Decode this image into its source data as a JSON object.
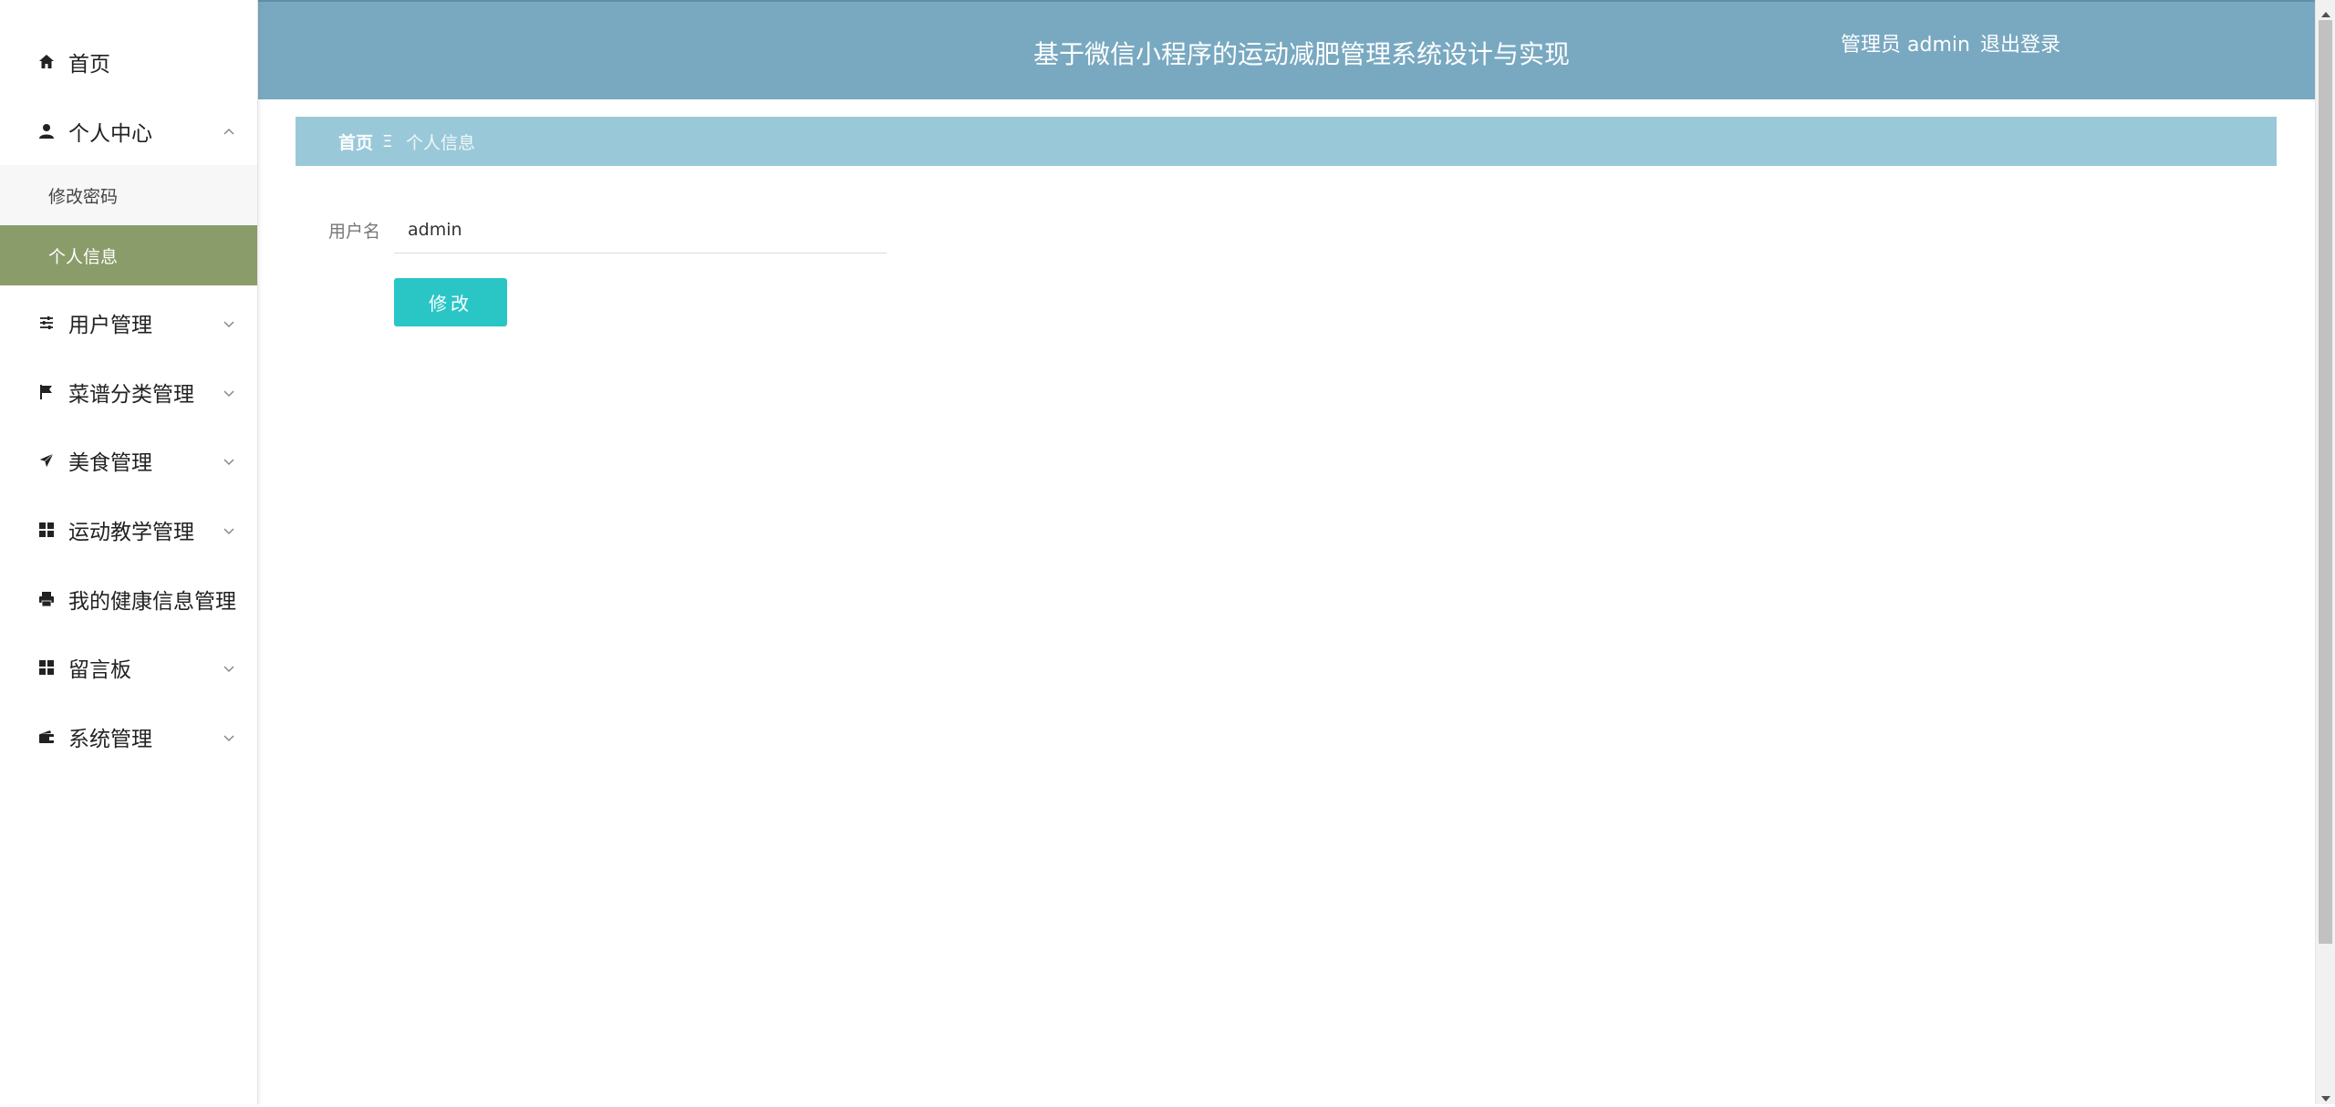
{
  "header": {
    "title": "基于微信小程序的运动减肥管理系统设计与实现",
    "user_text": "管理员 admin",
    "logout_label": "退出登录"
  },
  "sidebar": {
    "items": [
      {
        "label": "首页",
        "icon": "home-icon"
      },
      {
        "label": "个人中心",
        "icon": "user-icon",
        "expanded": true,
        "children": [
          {
            "label": "修改密码"
          },
          {
            "label": "个人信息",
            "active": true
          }
        ]
      },
      {
        "label": "用户管理",
        "icon": "sliders-icon"
      },
      {
        "label": "菜谱分类管理",
        "icon": "flag-icon"
      },
      {
        "label": "美食管理",
        "icon": "paper-plane-icon"
      },
      {
        "label": "运动教学管理",
        "icon": "grid-icon"
      },
      {
        "label": "我的健康信息管理",
        "icon": "printer-icon"
      },
      {
        "label": "留言板",
        "icon": "grid-icon"
      },
      {
        "label": "系统管理",
        "icon": "wallet-icon"
      }
    ]
  },
  "breadcrumb": {
    "home": "首页",
    "separator": "Ξ",
    "current": "个人信息"
  },
  "form": {
    "username_label": "用户名",
    "username_value": "admin",
    "submit_label": "修改"
  },
  "colors": {
    "header_bg": "#79a9c1",
    "breadcrumb_bg": "#99c9d9",
    "active_sub_bg": "#8a9c6a",
    "button_bg": "#2ac6c6"
  }
}
